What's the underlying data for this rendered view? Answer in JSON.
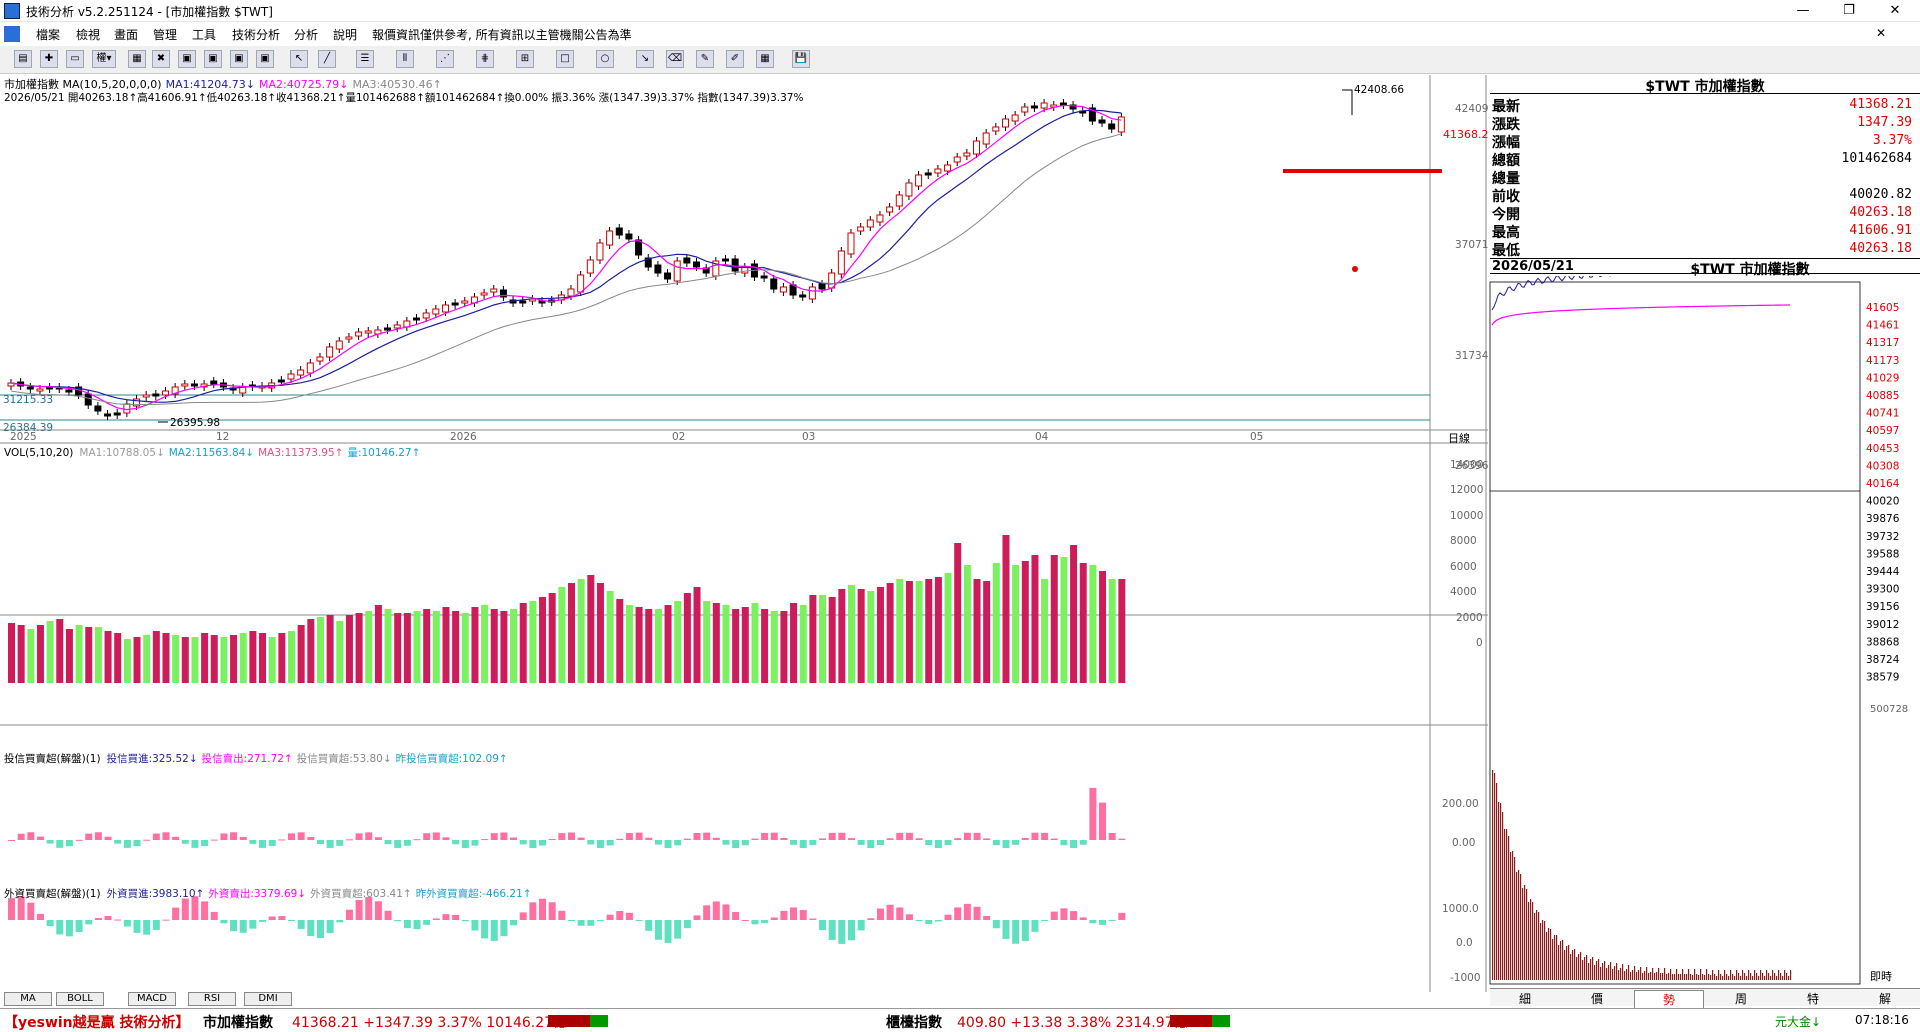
{
  "window": {
    "title": "技術分析 v5.2.251124 - [市加權指數 $TWT]"
  },
  "menu": [
    "檔案",
    "檢視",
    "畫面",
    "管理",
    "工具",
    "技術分析",
    "分析",
    "說明",
    "報價資訊僅供參考, 所有資訊以主管機關公告為準"
  ],
  "chart": {
    "header1": "市加權指數 MA(10,5,20,0,0,0)",
    "ma1": "MA1:41204.73↓",
    "ma2": "MA2:40725.79↓",
    "ma3": "MA3:40530.46↑",
    "header2": "2026/05/21 開40263.18↑高41606.91↑低40263.18↑收41368.21↑量101462688↑額101462684↑換0.00% 振3.36% 漲(1347.39)3.37% 指數(1347.39)3.37%",
    "price_ticks": [
      "42409",
      "37071",
      "31734",
      "26396"
    ],
    "price_current": "41368.2",
    "hline_label": "31215.33",
    "bottom_label": "26384.39",
    "peak_label": "42408.66",
    "low_label": "26395.98",
    "dates": [
      "2025",
      "12",
      "2026",
      "02",
      "03",
      "04",
      "05"
    ],
    "date_unit": "日線",
    "vol_header": "VOL(5,10,20)",
    "vol_ma1": "MA1:10788.05↓",
    "vol_ma2": "MA2:11563.84↓",
    "vol_ma3": "MA3:11373.95↑",
    "vol_now": "量:10146.27↑",
    "vol_ticks": [
      "14000",
      "12000",
      "10000",
      "8000",
      "6000",
      "4000",
      "2000",
      "0"
    ],
    "it_header": "投信買賣超(解盤)(1)",
    "it_buy": "投信買進:325.52↓",
    "it_sell": "投信賣出:271.72↑",
    "it_net": "投信買賣超:53.80↓",
    "it_prev": "昨投信買賣超:102.09↑",
    "it_ticks": [
      "200.00",
      "0.00"
    ],
    "fi_header": "外資買賣超(解盤)(1)",
    "fi_buy": "外資買進:3983.10↑",
    "fi_sell": "外資賣出:3379.69↓",
    "fi_net": "外資買賣超:603.41↑",
    "fi_prev": "昨外資買賣超:-466.21↑",
    "fi_ticks": [
      "1000.0",
      "0.0",
      "-1000"
    ],
    "bottom_tabs": [
      "MA",
      "BOLL",
      "MACD",
      "RSI",
      "DMI"
    ]
  },
  "quote": {
    "title": "$TWT 市加權指數",
    "rows": [
      {
        "label": "最新",
        "value": "41368.21",
        "color": "#e00000"
      },
      {
        "label": "漲跌",
        "value": "1347.39",
        "color": "#e00000"
      },
      {
        "label": "漲幅",
        "value": "3.37%",
        "color": "#e00000"
      },
      {
        "label": "總額",
        "value": "101462684",
        "color": "#000000"
      },
      {
        "label": "總量",
        "value": "",
        "color": "#000000"
      },
      {
        "label": "前收",
        "value": "40020.82",
        "color": "#000000"
      },
      {
        "label": "今開",
        "value": "40263.18",
        "color": "#e00000"
      },
      {
        "label": "最高",
        "value": "41606.91",
        "color": "#e00000"
      },
      {
        "label": "最低",
        "value": "40263.18",
        "color": "#e00000"
      }
    ]
  },
  "intraday": {
    "date": "2026/05/21",
    "title": "$TWT 市加權指數",
    "ticks": [
      "41605",
      "41461",
      "41317",
      "41173",
      "41029",
      "40885",
      "40741",
      "40597",
      "40453",
      "40308",
      "40164",
      "40020",
      "39876",
      "39732",
      "39588",
      "39444",
      "39300",
      "39156",
      "39012",
      "38868",
      "38724",
      "38579"
    ],
    "vol_max": "500728",
    "time_label": "即時"
  },
  "right_tabs": [
    "細",
    "價",
    "勢",
    "周",
    "特",
    "解"
  ],
  "status": {
    "app": "【yeswin越是贏 技術分析】",
    "idx1": "市加權指數",
    "idx1_val": "41368.21 +1347.39 3.37% 10146.27億",
    "idx2": "櫃檯指數",
    "idx2_val": "409.80 +13.38 3.38% 2314.97億",
    "fund": "元大金↓",
    "time": "07:18:16"
  },
  "colors": {
    "up": "#cc1c5a",
    "down": "#7bf060",
    "ma1": "#000000",
    "ma2": "#ff00ff",
    "ma3": "#1e1e9e",
    "red": "#e00000"
  }
}
